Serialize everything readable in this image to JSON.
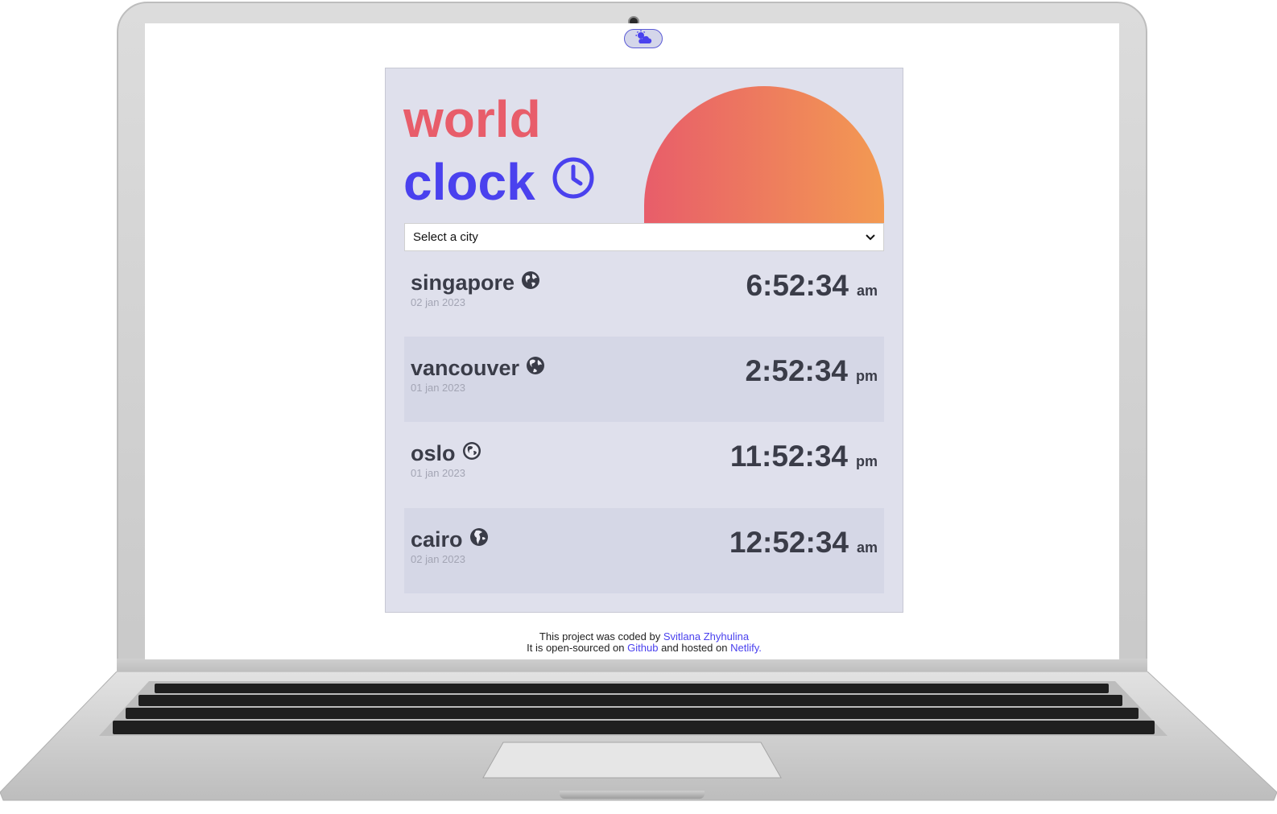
{
  "theme_toggle": {
    "icon": "cloud-sun-icon"
  },
  "header": {
    "title_word1": "world",
    "title_word2": "clock",
    "title_icon": "clock-icon"
  },
  "select": {
    "placeholder": "Select a city",
    "icon": "chevron-down-icon"
  },
  "cities": [
    {
      "name": "singapore",
      "date": "02 jan 2023",
      "time": "6:52:34",
      "ampm": "am",
      "icon": "globe-icon"
    },
    {
      "name": "vancouver",
      "date": "01 jan 2023",
      "time": "2:52:34",
      "ampm": "pm",
      "icon": "globe-icon"
    },
    {
      "name": "oslo",
      "date": "01 jan 2023",
      "time": "11:52:34",
      "ampm": "pm",
      "icon": "globe-icon"
    },
    {
      "name": "cairo",
      "date": "02 jan 2023",
      "time": "12:52:34",
      "ampm": "am",
      "icon": "globe-icon"
    }
  ],
  "footer": {
    "line1_prefix": "This project was coded by",
    "author": "Svitlana Zhyhulina",
    "line2_prefix": "It is open-sourced on",
    "github": "Github",
    "line2_middle": "and hosted on",
    "netlify": "Netlify."
  },
  "colors": {
    "accent_red": "#e85d6a",
    "accent_blue": "#4a41ee",
    "sun_end": "#f39a52",
    "card_bg": "#dfe0ec"
  }
}
